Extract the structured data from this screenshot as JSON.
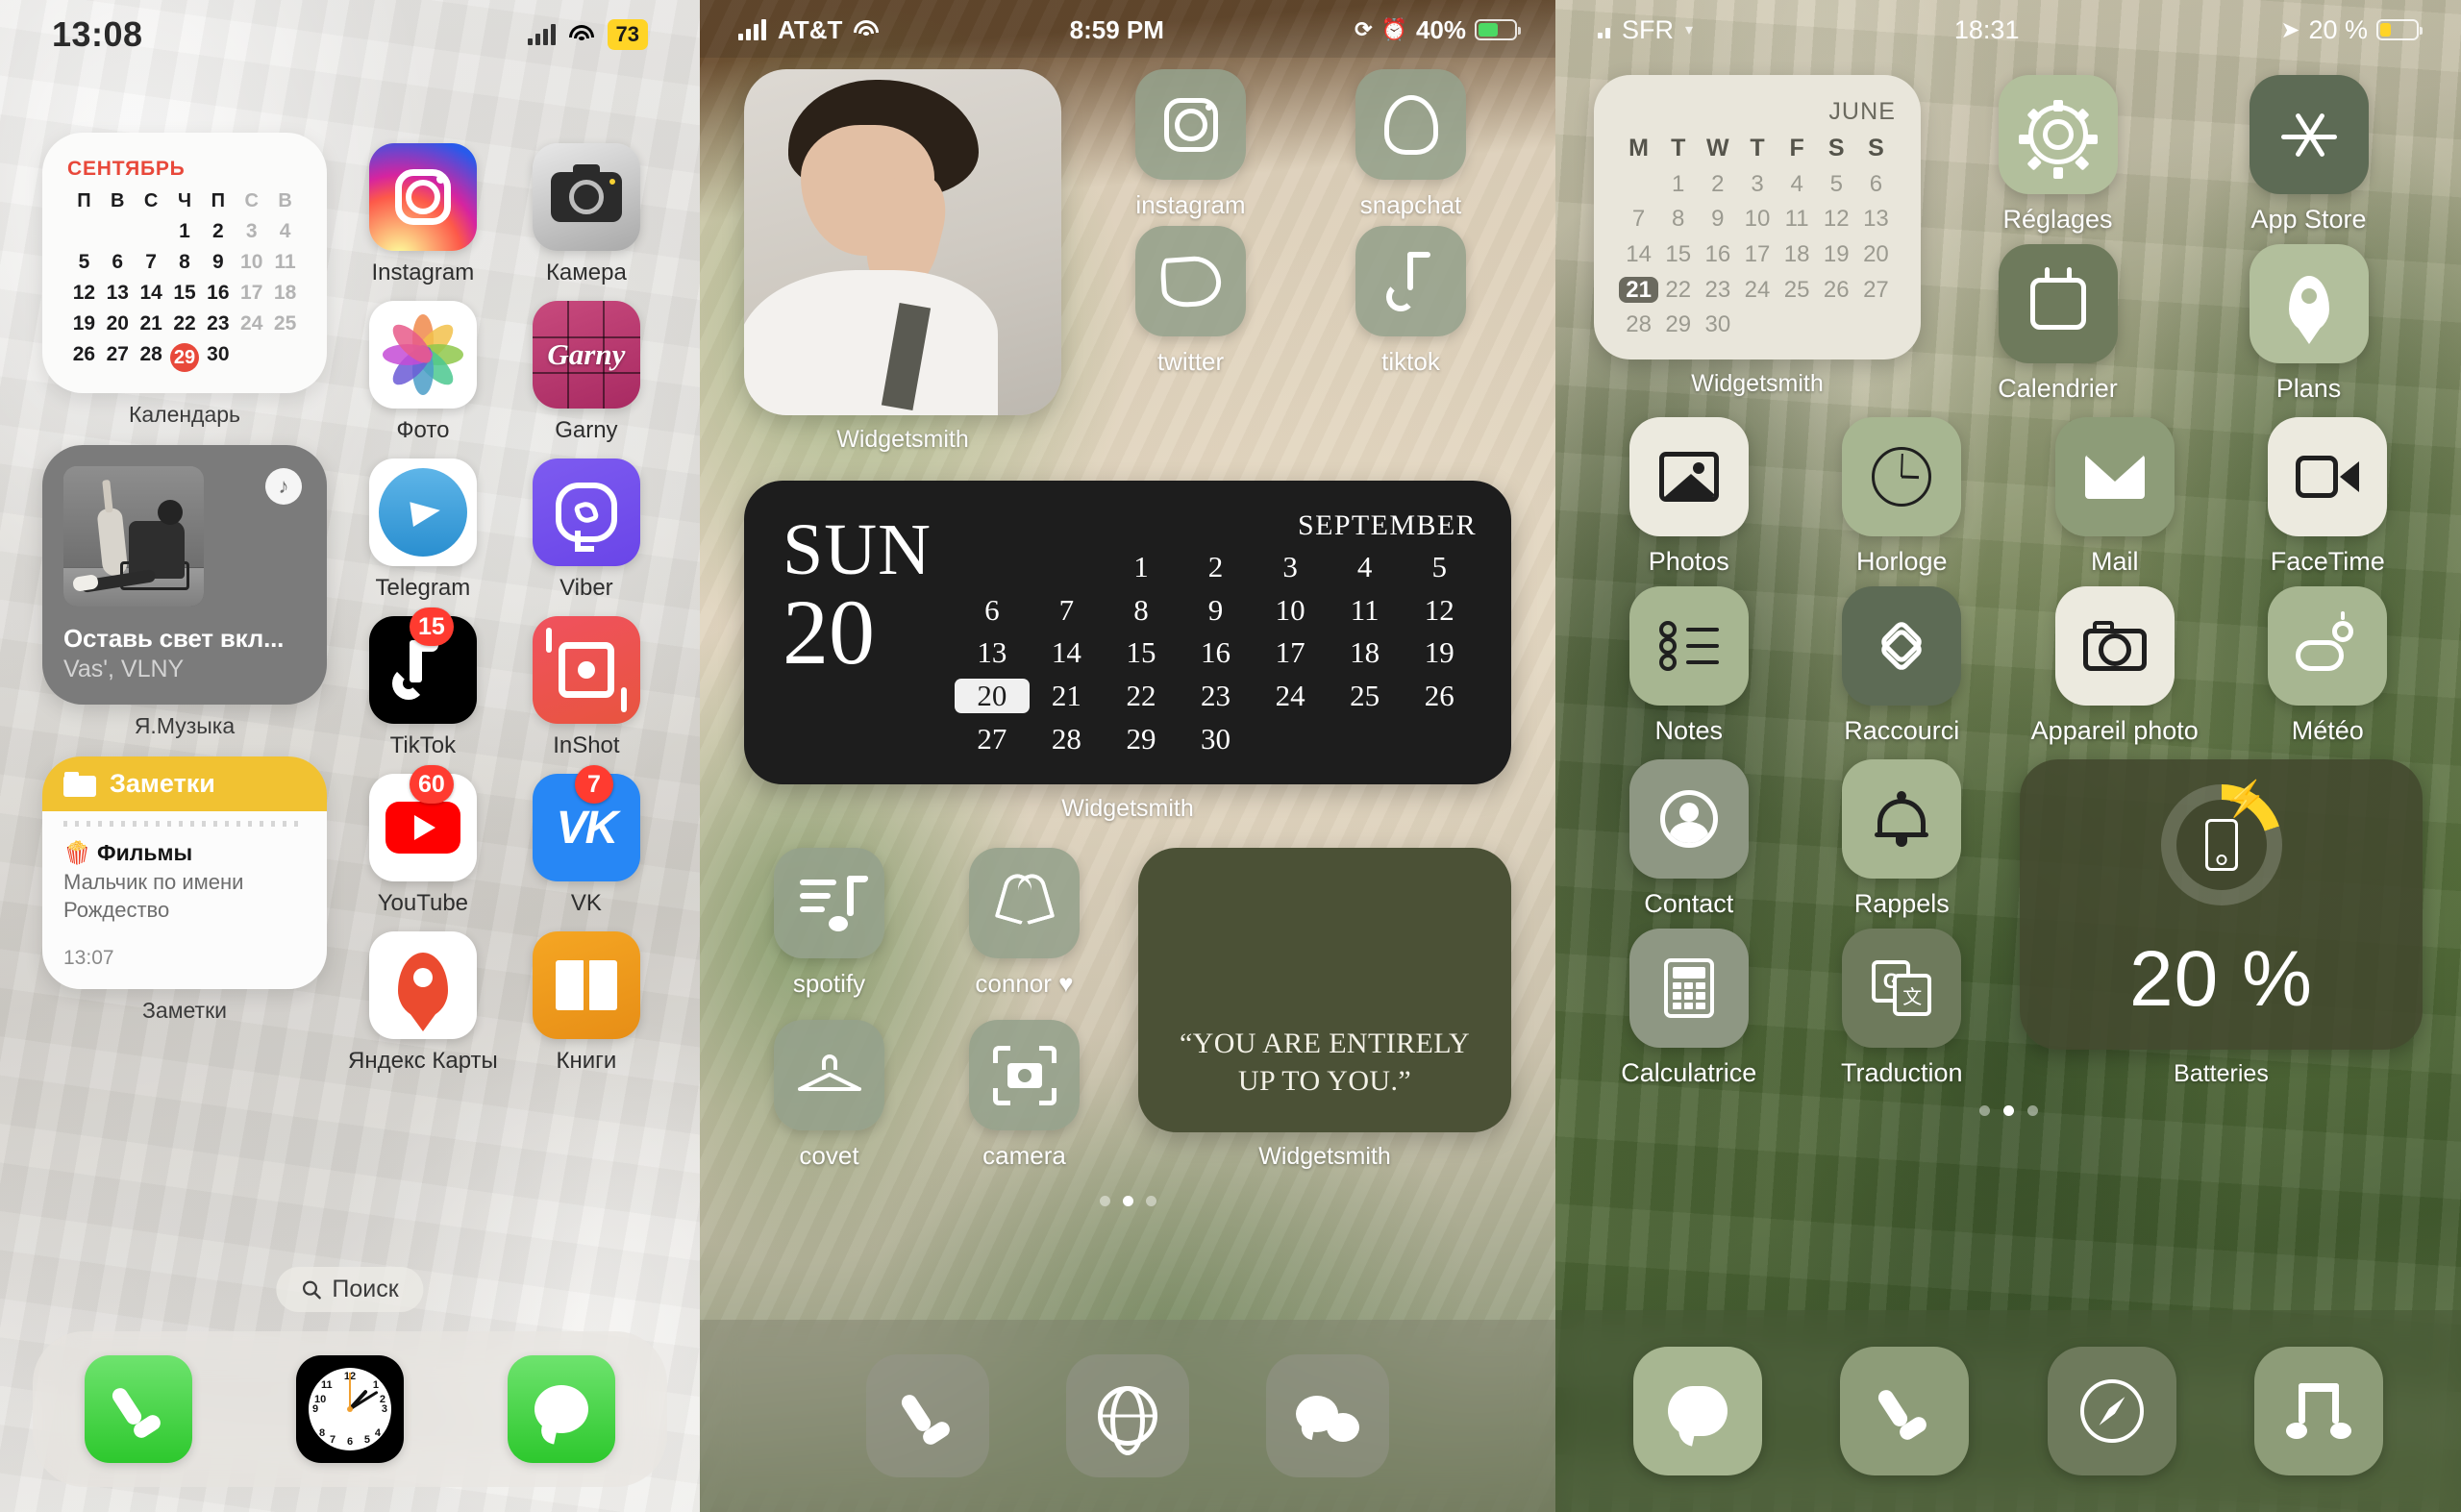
{
  "phone1": {
    "status": {
      "time": "13:08",
      "battery_badge": "73",
      "signal_icon": "signal-bars-icon",
      "wifi_icon": "wifi-icon"
    },
    "calendar_widget": {
      "month": "СЕНТЯБРЬ",
      "dow": [
        "П",
        "В",
        "С",
        "Ч",
        "П",
        "С",
        "В"
      ],
      "weeks": [
        [
          "",
          "",
          "",
          "1",
          "2",
          "3",
          "4"
        ],
        [
          "5",
          "6",
          "7",
          "8",
          "9",
          "10",
          "11"
        ],
        [
          "12",
          "13",
          "14",
          "15",
          "16",
          "17",
          "18"
        ],
        [
          "19",
          "20",
          "21",
          "22",
          "23",
          "24",
          "25"
        ],
        [
          "26",
          "27",
          "28",
          "29",
          "30",
          "",
          ""
        ]
      ],
      "today": "29",
      "label": "Календарь"
    },
    "music_widget": {
      "title": "Оставь свет вкл...",
      "artist": "Vas', VLNY",
      "label": "Я.Музыка",
      "badge_icon": "yandex-music-icon"
    },
    "notes_widget": {
      "header": "Заметки",
      "folder_icon": "folder-icon",
      "note_title": "🍿 Фильмы",
      "note_body": "Мальчик по имени Рождество",
      "note_time": "13:07",
      "label": "Заметки"
    },
    "apps": [
      {
        "name": "Instagram",
        "icon": "instagram-icon",
        "badge": null
      },
      {
        "name": "Камера",
        "icon": "camera-icon",
        "badge": null
      },
      {
        "name": "Фото",
        "icon": "photos-icon",
        "badge": null
      },
      {
        "name": "Garny",
        "icon": "garny-icon",
        "badge": null
      },
      {
        "name": "Telegram",
        "icon": "telegram-icon",
        "badge": null
      },
      {
        "name": "Viber",
        "icon": "viber-icon",
        "badge": null
      },
      {
        "name": "TikTok",
        "icon": "tiktok-icon",
        "badge": "15"
      },
      {
        "name": "InShot",
        "icon": "inshot-icon",
        "badge": null
      },
      {
        "name": "YouTube",
        "icon": "youtube-icon",
        "badge": "60"
      },
      {
        "name": "VK",
        "icon": "vk-icon",
        "badge": "7"
      },
      {
        "name": "Яндекс Карты",
        "icon": "yandex-maps-icon",
        "badge": null
      },
      {
        "name": "Книги",
        "icon": "books-icon",
        "badge": null
      }
    ],
    "search": {
      "label": "Поиск",
      "icon": "search-icon"
    },
    "dock": [
      {
        "name": "phone-app",
        "icon": "phone-icon"
      },
      {
        "name": "clock-app",
        "icon": "clock-icon"
      },
      {
        "name": "messages-app",
        "icon": "messages-icon"
      }
    ]
  },
  "phone2": {
    "status": {
      "carrier": "AT&T",
      "time": "8:59 PM",
      "battery_percent": "40%",
      "lock_icon": "rotation-lock-icon",
      "alarm_icon": "alarm-icon",
      "battery_icon": "battery-charging-icon"
    },
    "photo_widget": {
      "label": "Widgetsmith",
      "icon": "photo-widget"
    },
    "top_apps": [
      {
        "name": "instagram",
        "icon": "instagram-outline-icon"
      },
      {
        "name": "snapchat",
        "icon": "snapchat-icon"
      },
      {
        "name": "twitter",
        "icon": "twitter-icon"
      },
      {
        "name": "tiktok",
        "icon": "tiktok-outline-icon"
      }
    ],
    "big_calendar": {
      "weekday": "SUN",
      "day": "20",
      "month": "SEPTEMBER",
      "weeks": [
        [
          "",
          "",
          "1",
          "2",
          "3",
          "4",
          "5"
        ],
        [
          "6",
          "7",
          "8",
          "9",
          "10",
          "11",
          "12"
        ],
        [
          "13",
          "14",
          "15",
          "16",
          "17",
          "18",
          "19"
        ],
        [
          "20",
          "21",
          "22",
          "23",
          "24",
          "25",
          "26"
        ],
        [
          "27",
          "28",
          "29",
          "30",
          "",
          "",
          ""
        ]
      ],
      "current": "20",
      "label": "Widgetsmith"
    },
    "bottom_apps": [
      {
        "name": "spotify",
        "icon": "spotify-outline-icon"
      },
      {
        "name": "connor ♥",
        "icon": "heart-outline-icon"
      },
      {
        "name": "covet",
        "icon": "hanger-icon"
      },
      {
        "name": "camera",
        "icon": "camera-outline-icon"
      }
    ],
    "quote_widget": {
      "text": "“YOU ARE ENTIRELY UP TO YOU.”",
      "label": "Widgetsmith"
    },
    "page_dots": {
      "count": 3,
      "active": 1
    },
    "dock": [
      {
        "name": "phone-app",
        "icon": "phone-icon"
      },
      {
        "name": "safari-app",
        "icon": "globe-icon"
      },
      {
        "name": "messages-app",
        "icon": "messages-icon"
      }
    ]
  },
  "phone3": {
    "status": {
      "carrier": "SFR",
      "time": "18:31",
      "battery_percent": "20 %",
      "location_icon": "location-arrow-icon",
      "battery_icon": "battery-charging-icon"
    },
    "calendar_widget": {
      "month": "JUNE",
      "dow": [
        "M",
        "T",
        "W",
        "T",
        "F",
        "S",
        "S"
      ],
      "weeks": [
        [
          "",
          "1",
          "2",
          "3",
          "4",
          "5",
          "6"
        ],
        [
          "7",
          "8",
          "9",
          "10",
          "11",
          "12",
          "13"
        ],
        [
          "14",
          "15",
          "16",
          "17",
          "18",
          "19",
          "20"
        ],
        [
          "21",
          "22",
          "23",
          "24",
          "25",
          "26",
          "27"
        ],
        [
          "28",
          "29",
          "30",
          "",
          "",
          "",
          ""
        ]
      ],
      "today": "21",
      "label": "Widgetsmith"
    },
    "apps": [
      {
        "name": "Réglages",
        "icon": "gear-icon",
        "bg": "bg-lgreen"
      },
      {
        "name": "App Store",
        "icon": "app-store-icon",
        "bg": "bg-dgreen"
      },
      {
        "name": "Calendrier",
        "icon": "calendar-icon",
        "bg": "bg-olive"
      },
      {
        "name": "Plans",
        "icon": "map-pin-icon",
        "bg": "bg-lgreen"
      },
      {
        "name": "Photos",
        "icon": "photos-icon",
        "bg": "bg-cream"
      },
      {
        "name": "Horloge",
        "icon": "clock-icon",
        "bg": "bg-sage"
      },
      {
        "name": "Mail",
        "icon": "mail-icon",
        "bg": "bg-mgreen"
      },
      {
        "name": "FaceTime",
        "icon": "facetime-icon",
        "bg": "bg-cream"
      },
      {
        "name": "Notes",
        "icon": "notes-icon",
        "bg": "bg-sage"
      },
      {
        "name": "Raccourci",
        "icon": "shortcuts-icon",
        "bg": "bg-dgreen"
      },
      {
        "name": "Appareil photo",
        "icon": "camera-icon",
        "bg": "bg-cream"
      },
      {
        "name": "Météo",
        "icon": "weather-icon",
        "bg": "bg-sage"
      },
      {
        "name": "Contact",
        "icon": "contacts-icon",
        "bg": "bg-grey"
      },
      {
        "name": "Rappels",
        "icon": "bell-icon",
        "bg": "bg-sage"
      },
      {
        "name": "Calculatrice",
        "icon": "calculator-icon",
        "bg": "bg-grey"
      },
      {
        "name": "Traduction",
        "icon": "translate-icon",
        "bg": "bg-olive"
      }
    ],
    "battery_widget": {
      "percent": "20 %",
      "label": "Batteries",
      "ring_color": "#FFD426",
      "bolt_icon": "bolt-icon",
      "phone_icon": "iphone-icon"
    },
    "page_dots": {
      "count": 3,
      "active": 1
    },
    "dock": [
      {
        "name": "messages-app",
        "icon": "messages-icon"
      },
      {
        "name": "phone-app",
        "icon": "phone-icon"
      },
      {
        "name": "safari-app",
        "icon": "compass-icon"
      },
      {
        "name": "music-app",
        "icon": "music-note-icon"
      }
    ]
  }
}
